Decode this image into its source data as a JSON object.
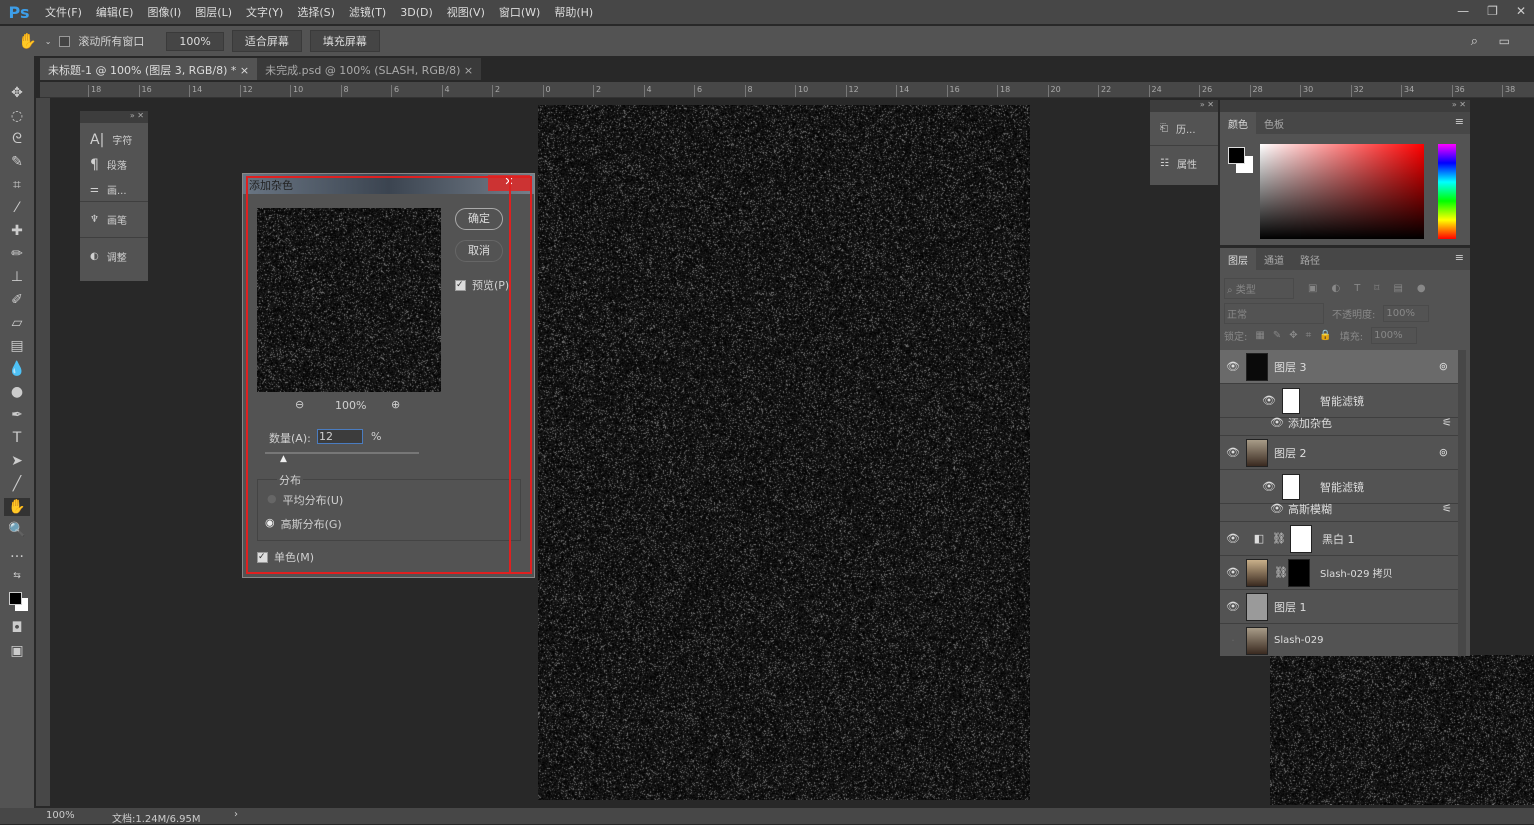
{
  "app": {
    "logo": "Ps"
  },
  "menu": [
    "文件(F)",
    "编辑(E)",
    "图像(I)",
    "图层(L)",
    "文字(Y)",
    "选择(S)",
    "滤镜(T)",
    "3D(D)",
    "视图(V)",
    "窗口(W)",
    "帮助(H)"
  ],
  "window_controls": [
    "—",
    "❐",
    "✕"
  ],
  "options": {
    "scroll_all": "滚动所有窗口",
    "zoom": "100%",
    "fit_screen": "适合屏幕",
    "fill_screen": "填充屏幕"
  },
  "tabs": [
    {
      "label": "未标题-1 @ 100% (图层 3, RGB/8) *",
      "close": "×"
    },
    {
      "label": "未完成.psd @ 100% (SLASH, RGB/8)",
      "close": "×"
    }
  ],
  "ruler_labels": [
    "18",
    "16",
    "14",
    "12",
    "10",
    "8",
    "6",
    "4",
    "2",
    "0",
    "2",
    "4",
    "6",
    "8",
    "10",
    "12",
    "14",
    "16",
    "18",
    "20",
    "22",
    "24",
    "26",
    "28",
    "30",
    "32",
    "34",
    "36",
    "38"
  ],
  "mini_panel": {
    "items": [
      "字符",
      "段落",
      "画...",
      "画笔",
      "调整"
    ]
  },
  "side_panel": {
    "items": [
      "历...",
      "属性"
    ]
  },
  "dialog": {
    "title": "添加杂色",
    "ok": "确定",
    "cancel": "取消",
    "preview": "预览(P)",
    "preview_checked": true,
    "zoom": "100%",
    "amount_label": "数量(A):",
    "amount": "12",
    "amount_unit": "%",
    "distribution_label": "分布",
    "uniform": "平均分布(U)",
    "gaussian": "高斯分布(G)",
    "selected_distribution": "gaussian",
    "mono": "单色(M)",
    "mono_checked": true
  },
  "color_panel": {
    "tabs": [
      "颜色",
      "色板"
    ],
    "foreground": "#000000",
    "background": "#ffffff"
  },
  "layers_panel": {
    "tabs": [
      "图层",
      "通道",
      "路径"
    ],
    "filter": "类型",
    "blend": "正常",
    "opacity_label": "不透明度:",
    "opacity": "100%",
    "lock_label": "锁定:",
    "fill_label": "填充:",
    "fill": "100%",
    "rows": [
      {
        "name": "图层 3",
        "type": "layer",
        "selected": true
      },
      {
        "name": "智能滤镜",
        "type": "smart"
      },
      {
        "name": "添加杂色",
        "type": "filter"
      },
      {
        "name": "图层 2",
        "type": "layer"
      },
      {
        "name": "智能滤镜",
        "type": "smart"
      },
      {
        "name": "高斯模糊",
        "type": "filter"
      },
      {
        "name": "黑白 1",
        "type": "adjust"
      },
      {
        "name": "Slash-029 拷贝",
        "type": "masked"
      },
      {
        "name": "图层 1",
        "type": "layer"
      },
      {
        "name": "Slash-029",
        "type": "layer"
      }
    ]
  },
  "status": {
    "zoom": "100%",
    "doc": "文档:1.24M/6.95M",
    "arrow": "›"
  }
}
